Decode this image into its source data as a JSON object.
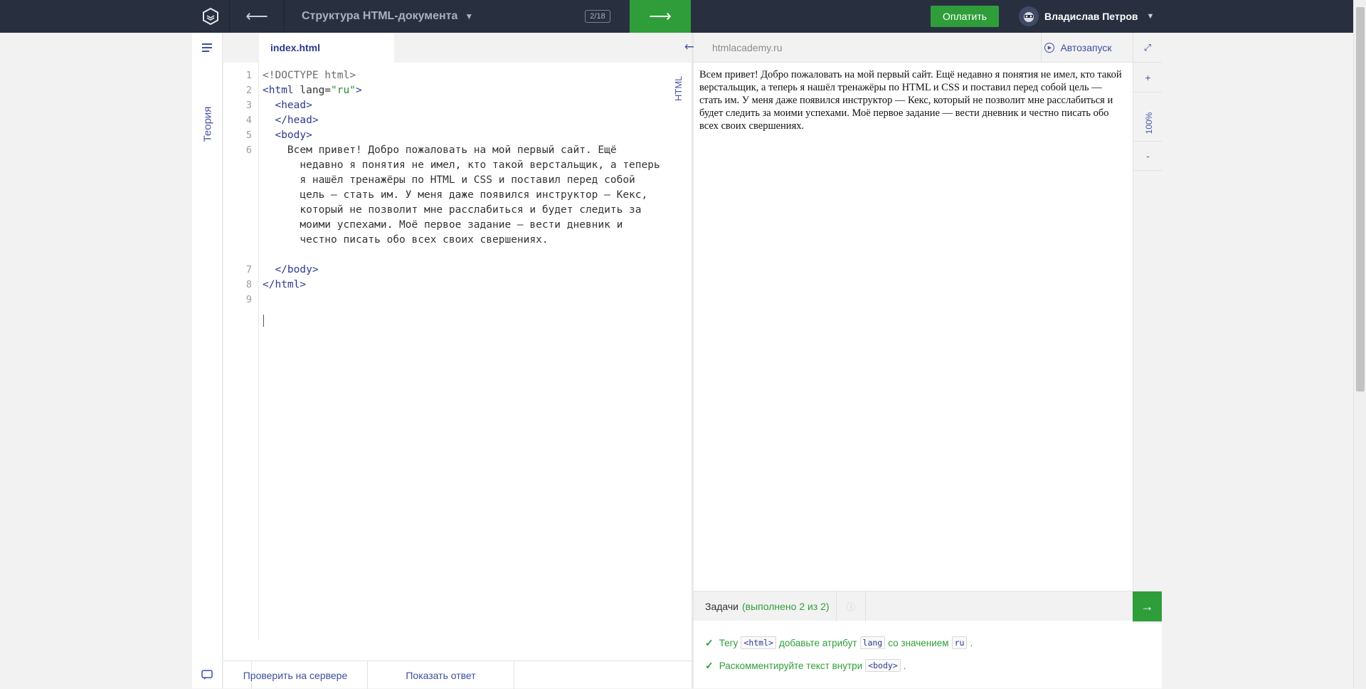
{
  "topbar": {
    "lesson_title": "Структура HTML-документа",
    "progress": "2/18",
    "pay_label": "Оплатить",
    "user_name": "Владислав Петров"
  },
  "sidebar": {
    "theory_label": "Теория"
  },
  "editor": {
    "tab_label": "index.html",
    "language_label": "HTML",
    "line_numbers": [
      "1",
      "2",
      "3",
      "4",
      "5",
      "6",
      "7",
      "8",
      "9"
    ],
    "code": {
      "l1": "<!DOCTYPE html>",
      "l2_open": "<html",
      "l2_attr": " lang=",
      "l2_val": "\"ru\"",
      "l2_close": ">",
      "l3": "  <head>",
      "l4": "  </head>",
      "l5": "  <body>",
      "l6a": "    Всем привет! Добро пожаловать на мой первый сайт. Ещё",
      "l6b": "      недавно я понятия не имел, кто такой верстальщик, а теперь",
      "l6c": "      я нашёл тренажёры по HTML и CSS и поставил перед собой",
      "l6d": "      цель — стать им. У меня даже появился инструктор — Кекс,",
      "l6e": "      который не позволит мне расслабиться и будет следить за",
      "l6f": "      моими успехами. Моё первое задание — вести дневник и",
      "l6g": "      честно писать обо всех своих свершениях.",
      "l7": "  </body>",
      "l8": "</html>"
    },
    "check_button": "Проверить на сервере",
    "answer_button": "Показать ответ"
  },
  "preview": {
    "url": "htmlacademy.ru",
    "autorun_label": "Автозапуск",
    "zoom": "100%",
    "zoom_in": "+",
    "zoom_out": "-",
    "body_text": "Всем привет! Добро пожаловать на мой первый сайт. Ещё недавно я понятия не имел, кто такой верстальщик, а теперь я нашёл тренажёры по HTML и CSS и поставил перед собой цель — стать им. У меня даже появился инструктор — Кекс, который не позволит мне расслабиться и будет следить за моими успехами. Моё первое задание — вести дневник и честно писать обо всех своих свершениях."
  },
  "tasks": {
    "title": "Задачи",
    "status": "(выполнено 2 из 2)",
    "items": [
      {
        "pre": "Тегу",
        "chip1": "<html>",
        "mid": "добавьте атрибут",
        "chip2": "lang",
        "mid2": "со значением",
        "chip3": "ru",
        "post": "."
      },
      {
        "pre": "Раскомментируйте текст внутри",
        "chip1": "<body>",
        "post": "."
      }
    ]
  },
  "colors": {
    "topbar": "#283040",
    "accent_green": "#2f9e3a",
    "link_blue": "#3e4fa0",
    "tag_blue": "#2d3a8c"
  }
}
